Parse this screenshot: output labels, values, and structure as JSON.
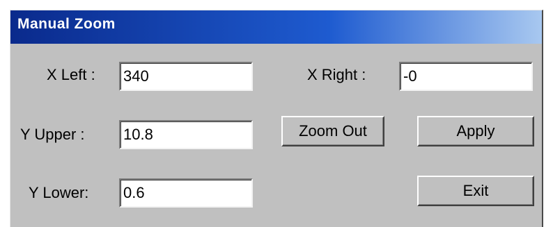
{
  "window": {
    "title": "Manual Zoom"
  },
  "fields": {
    "x_left": {
      "label": "X Left :",
      "value": "340"
    },
    "x_right": {
      "label": "X Right :",
      "value": "-0"
    },
    "y_upper": {
      "label": "Y Upper :",
      "value": "10.8"
    },
    "y_lower": {
      "label": "Y Lower:",
      "value": "0.6"
    }
  },
  "buttons": {
    "zoom_out": "Zoom Out",
    "apply": "Apply",
    "exit": "Exit"
  },
  "colors": {
    "title_start": "#0a2a8c",
    "title_end": "#a8c8f0",
    "face": "#c0c0c0"
  }
}
